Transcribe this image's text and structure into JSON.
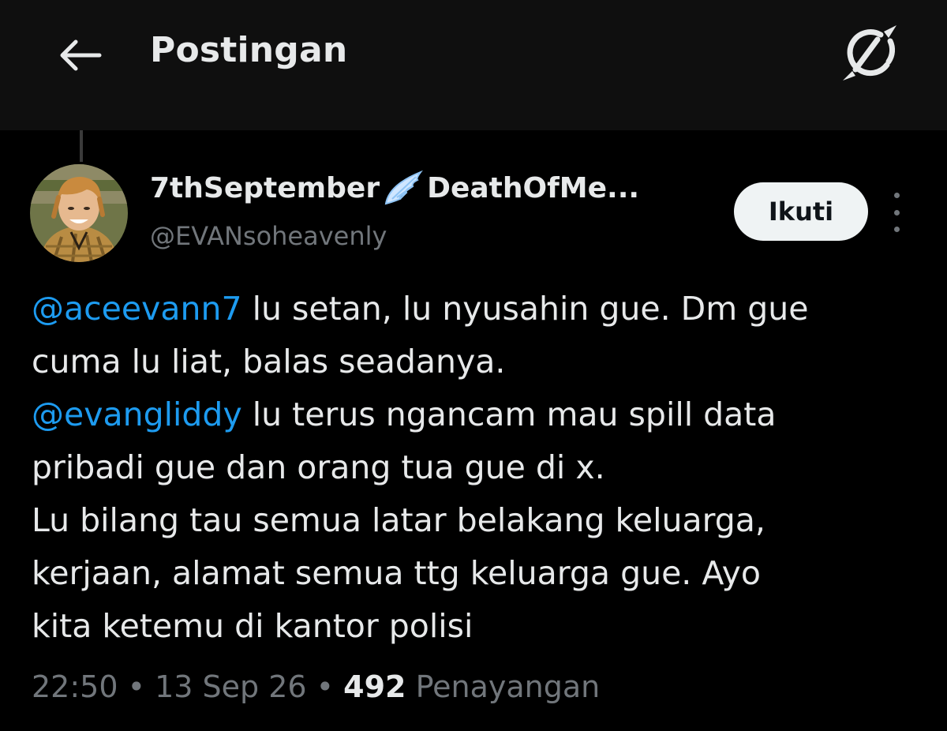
{
  "header": {
    "title": "Postingan",
    "back_icon": "arrow-left-icon",
    "grok_icon": "grok-icon"
  },
  "author": {
    "display_name_part1": "7thSeptember",
    "display_name_emoji": "wing-icon",
    "display_name_part2": "DeathOfMe...",
    "handle": "@EVANsoheavenly",
    "avatar": "avatar-photo"
  },
  "follow_label": "Ikuti",
  "more_icon": "more-vertical-icon",
  "tweet": {
    "line1_mention": "@aceevann7",
    "line1_text": " lu setan, lu nyusahin gue. Dm gue",
    "line2_text": "cuma lu liat, balas seadanya.",
    "line3_mention": "@evangliddy",
    "line3_text": " lu terus ngancam mau spill data",
    "line4_text": "pribadi gue dan orang tua gue di x.",
    "line5_text": "Lu bilang tau semua latar belakang keluarga,",
    "line6_text": "kerjaan, alamat semua ttg keluarga gue. Ayo",
    "line7_text": "kita ketemu di kantor polisi"
  },
  "meta": {
    "time": "22:50",
    "separator": " • ",
    "date": "13 Sep 26",
    "views_count": "492",
    "views_label": " Penayangan"
  },
  "colors": {
    "background": "#000000",
    "topbar": "#0f0f0f",
    "text": "#e7e9ea",
    "secondary": "#71767b",
    "link": "#1d9bf0",
    "follow_bg": "#eff3f4"
  }
}
